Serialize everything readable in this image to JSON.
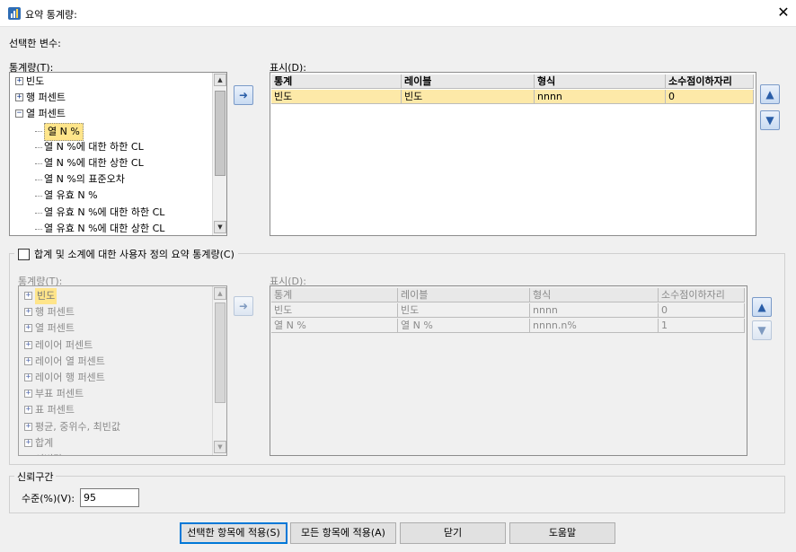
{
  "window": {
    "title": "요약 통계량:",
    "close_glyph": "✕"
  },
  "selected_variables_label": "선택한 변수:",
  "top": {
    "stats_label": "통계량(T):",
    "display_label": "표시(D):",
    "tree": [
      {
        "label": "빈도",
        "expander": "+"
      },
      {
        "label": "행 퍼센트",
        "expander": "+"
      },
      {
        "label": "열 퍼센트",
        "expander": "−"
      },
      {
        "label": "열 N %",
        "selected": true
      },
      {
        "label": "열 N %에 대한 하한 CL"
      },
      {
        "label": "열 N %에 대한 상한 CL"
      },
      {
        "label": "열 N %의 표준오차"
      },
      {
        "label": "열 유효 N %"
      },
      {
        "label": "열 유효 N %에 대한 하한 CL"
      },
      {
        "label": "열 유효 N %에 대한 상한 CL"
      }
    ],
    "grid": {
      "headers": [
        "통계",
        "레이블",
        "형식",
        "소수점이하자리"
      ],
      "rows": [
        [
          "빈도",
          "빈도",
          "nnnn",
          "0"
        ]
      ]
    }
  },
  "custom": {
    "checkbox_label": "합계 및 소계에 대한 사용자 정의 요약 통계량(C)",
    "stats_label": "통계량(T):",
    "display_label": "표시(D):",
    "tree": [
      {
        "label": "빈도",
        "expander": "+",
        "highlight": true
      },
      {
        "label": "행 퍼센트",
        "expander": "+"
      },
      {
        "label": "열 퍼센트",
        "expander": "+"
      },
      {
        "label": "레이어 퍼센트",
        "expander": "+"
      },
      {
        "label": "레이어 열 퍼센트",
        "expander": "+"
      },
      {
        "label": "레이어 행 퍼센트",
        "expander": "+"
      },
      {
        "label": "부표 퍼센트",
        "expander": "+"
      },
      {
        "label": "표 퍼센트",
        "expander": "+"
      },
      {
        "label": "평균, 중위수, 최빈값",
        "expander": "+"
      },
      {
        "label": "합계",
        "expander": "+"
      },
      {
        "label": "이변량",
        "expander": "+"
      }
    ],
    "grid": {
      "headers": [
        "통계",
        "레이블",
        "형식",
        "소수점이하자리"
      ],
      "rows": [
        [
          "빈도",
          "빈도",
          "nnnn",
          "0"
        ],
        [
          "열 N %",
          "열 N %",
          "nnnn.n%",
          "1"
        ]
      ]
    }
  },
  "ci": {
    "group_label": "신뢰구간",
    "level_label": "수준(%)(V):",
    "level_value": "95"
  },
  "buttons": {
    "apply_selection": "선택한 항목에 적용(S)",
    "apply_all": "모든 항목에 적용(A)",
    "close": "닫기",
    "help": "도움말"
  },
  "icons": {
    "move_right": "arrow-right-icon",
    "move_up": "arrow-up-icon",
    "move_down": "arrow-down-icon",
    "app": "spss-app-icon",
    "close": "close-icon",
    "checkbox": "checkbox-icon"
  }
}
